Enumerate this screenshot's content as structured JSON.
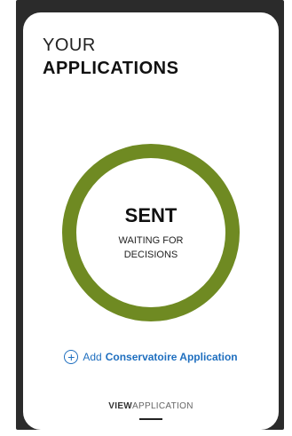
{
  "header": {
    "title_line1": "YOUR",
    "title_line2": "APPLICATIONS"
  },
  "status": {
    "label": "SENT",
    "detail": "WAITING FOR DECISIONS",
    "ring_color": "#6f8a22"
  },
  "actions": {
    "add_prefix": "Add",
    "add_label": "Conservatoire Application",
    "add_icon": "plus-circle-icon",
    "view_bold": "VIEW",
    "view_light": "APPLICATION",
    "link_color": "#1f6fbf"
  }
}
